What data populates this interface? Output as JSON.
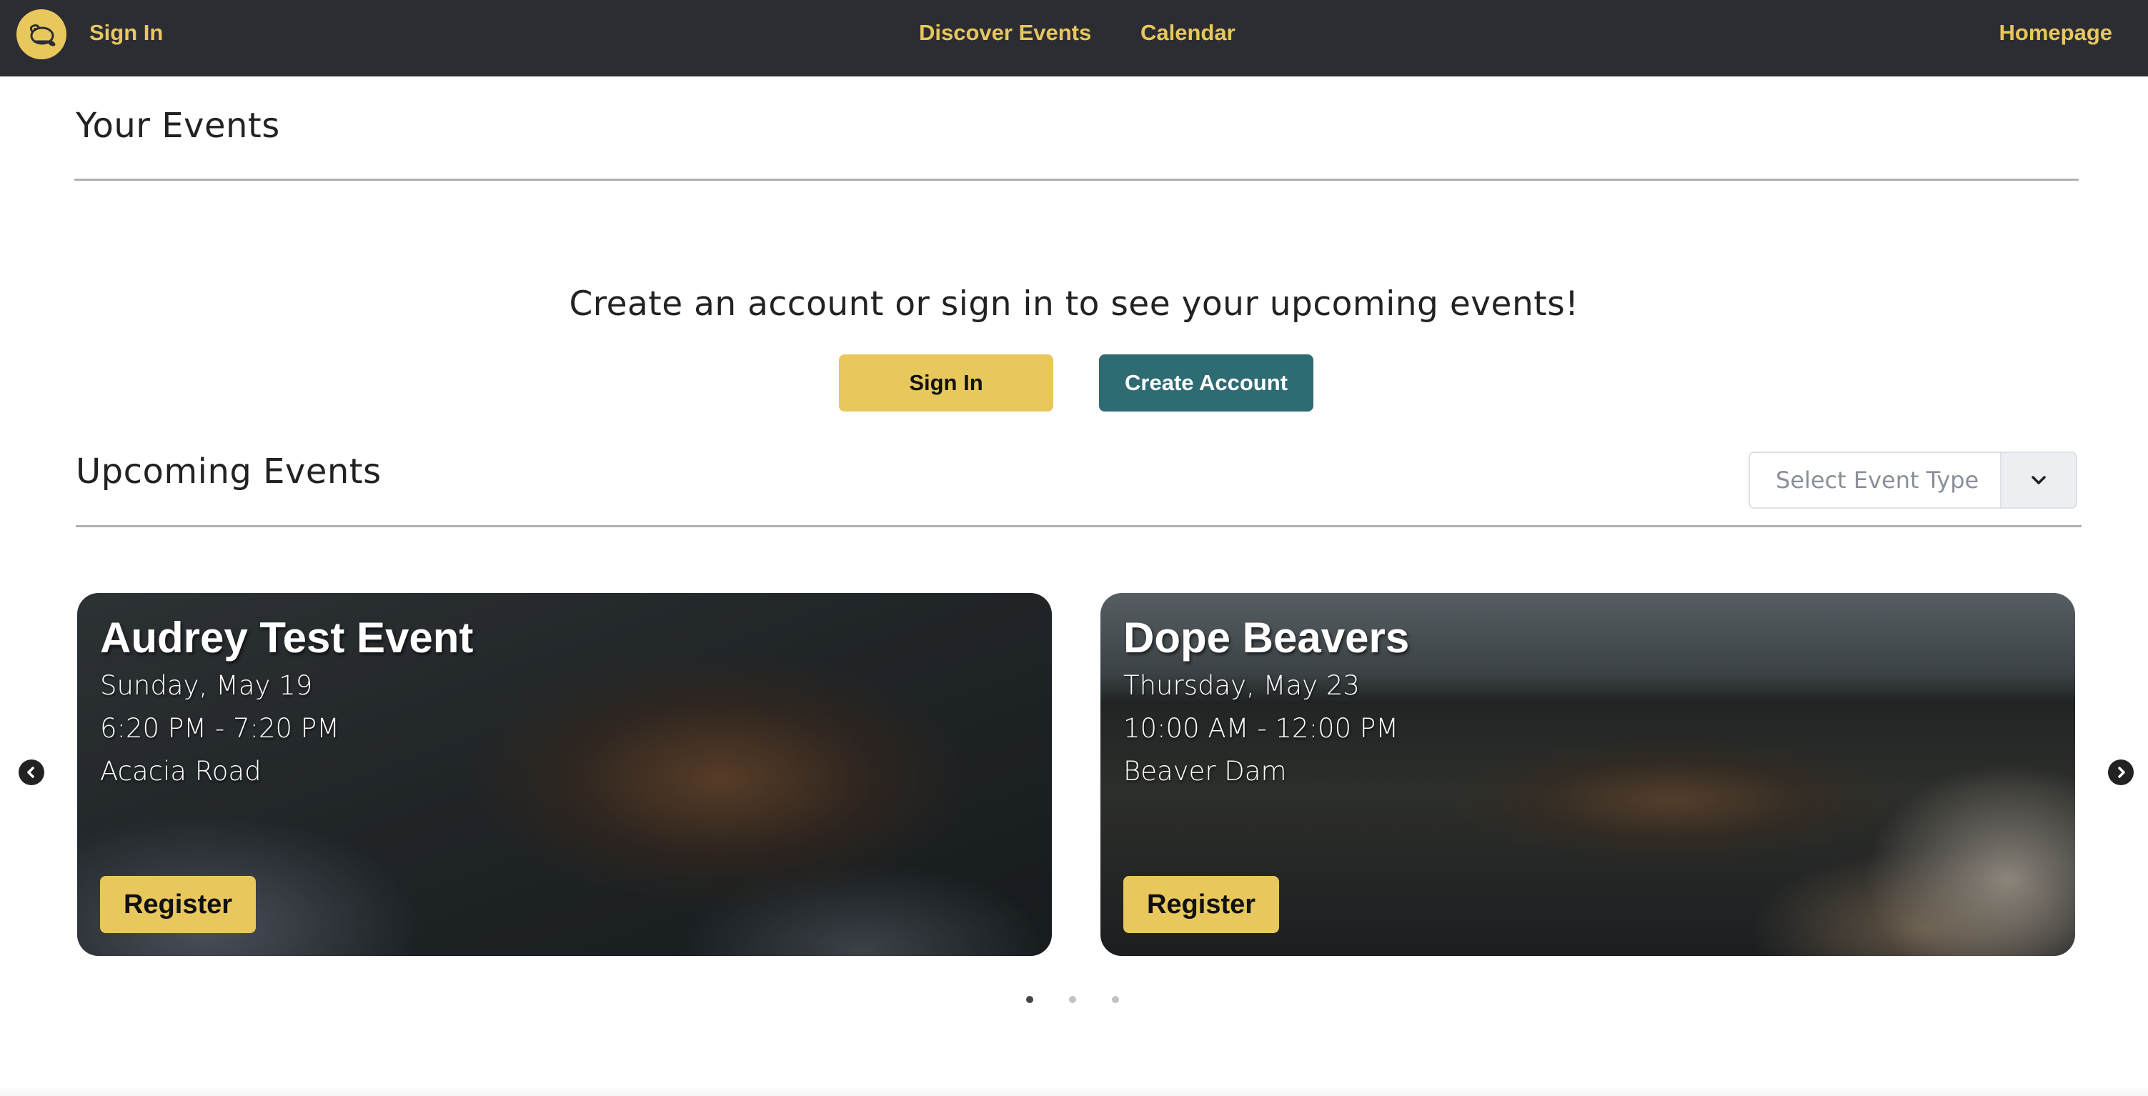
{
  "nav": {
    "logo_icon": "beaver-logo-icon",
    "sign_in": "Sign In",
    "discover": "Discover Events",
    "calendar": "Calendar",
    "homepage": "Homepage"
  },
  "your_events": {
    "title": "Your Events",
    "prompt": "Create an account or sign in to see your upcoming events!",
    "sign_in_button": "Sign In",
    "create_account_button": "Create Account"
  },
  "upcoming": {
    "title": "Upcoming Events",
    "filter": {
      "placeholder": "Select Event Type",
      "icon": "chevron-down-icon"
    },
    "events": [
      {
        "title": "Audrey Test Event",
        "date": "Sunday, May 19",
        "time": "6:20 PM - 7:20 PM",
        "location": "Acacia Road",
        "button": "Register"
      },
      {
        "title": "Dope Beavers",
        "date": "Thursday, May 23",
        "time": "10:00 AM - 12:00 PM",
        "location": "Beaver Dam",
        "button": "Register"
      }
    ],
    "pagination": {
      "total": 3,
      "active": 1
    }
  },
  "colors": {
    "navbar": "#2c2d33",
    "accent_gold": "#e8c75c",
    "accent_teal": "#2f6b73"
  }
}
